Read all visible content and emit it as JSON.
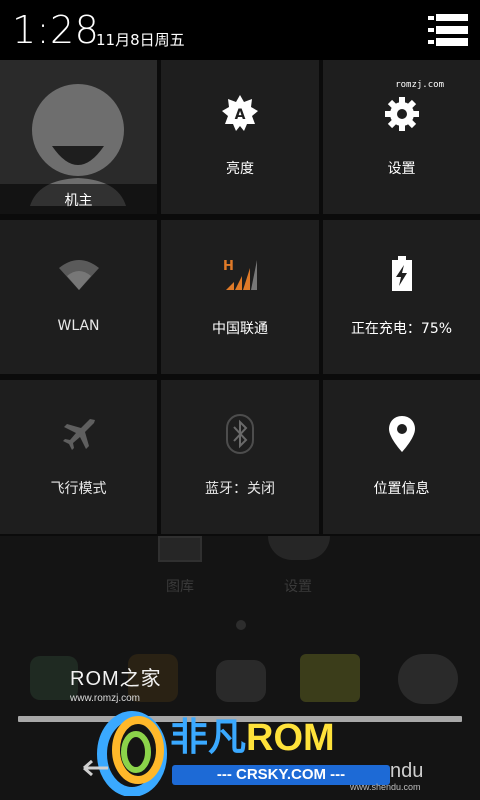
{
  "status_bar": {
    "time": "1:28",
    "date": "11月8日周五",
    "menu_icon": "quick-settings-list-icon"
  },
  "tiles": [
    {
      "id": "owner",
      "label": "机主",
      "icon": "avatar"
    },
    {
      "id": "brightness",
      "label": "亮度",
      "icon": "brightness-auto-icon"
    },
    {
      "id": "settings",
      "label": "设置",
      "icon": "gear-icon"
    },
    {
      "id": "wlan",
      "label": "WLAN",
      "icon": "wifi-icon"
    },
    {
      "id": "mobile",
      "label": "中国联通",
      "icon": "signal-h-icon"
    },
    {
      "id": "battery",
      "label": "正在充电：75%",
      "icon": "battery-charging-icon",
      "level_percent": 75
    },
    {
      "id": "airplane",
      "label": "飞行模式",
      "icon": "airplane-icon"
    },
    {
      "id": "bluetooth",
      "label": "蓝牙：关闭",
      "icon": "bluetooth-icon"
    },
    {
      "id": "location",
      "label": "位置信息",
      "icon": "location-pin-icon"
    }
  ],
  "watermark_small": "romzj.com",
  "home": {
    "apps": [
      "图库",
      "设置"
    ]
  },
  "overlay_logos": {
    "romzj_title": "ROM之家",
    "romzj_url": "www.romzj.com",
    "feifan_cn": "非凡",
    "feifan_rom": "ROM",
    "feifan_sub": "--- CRSKY.COM ---",
    "shendu": "ndu",
    "shendu_url": "www.shendu.com"
  },
  "colors": {
    "accent_orange": "#e07a28",
    "tile_bg": "#1e1e1e",
    "text": "#ffffff"
  }
}
